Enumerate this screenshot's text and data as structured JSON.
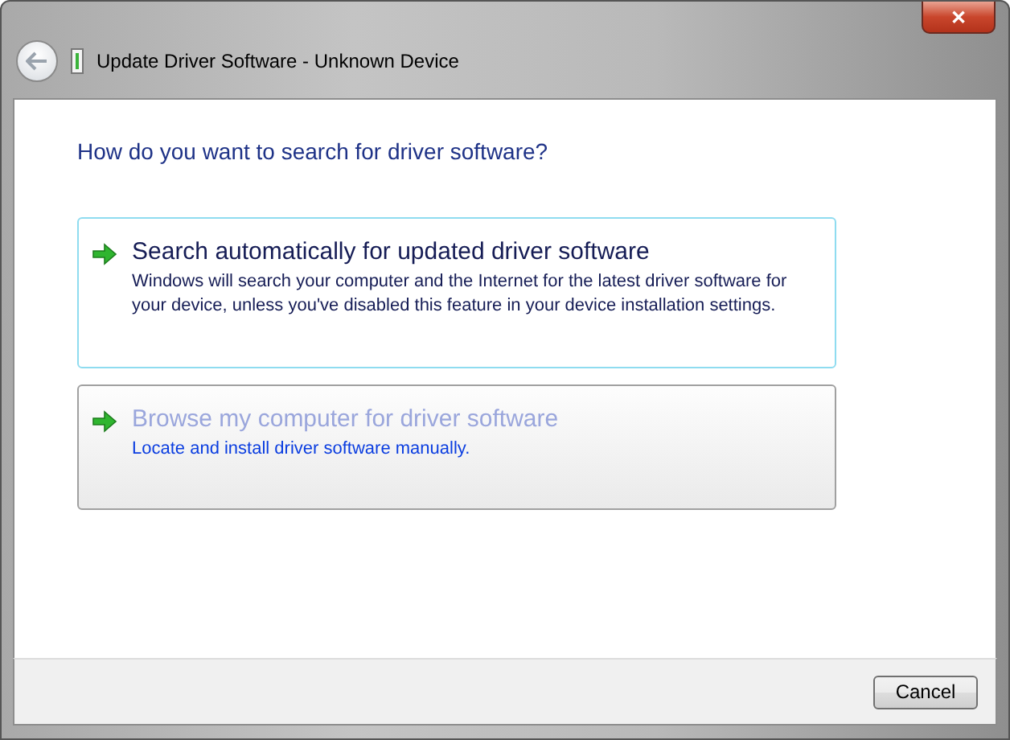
{
  "window": {
    "title": "Update Driver Software - Unknown Device",
    "close": "✕"
  },
  "heading": "How do you want to search for driver software?",
  "options": [
    {
      "title": "Search automatically for updated driver software",
      "description": "Windows will search your computer and the Internet for the latest driver software for your device, unless you've disabled this feature in your device installation settings.",
      "focused": true,
      "hovered": false
    },
    {
      "title": "Browse my computer for driver software",
      "description": "Locate and install driver software manually.",
      "focused": false,
      "hovered": true
    }
  ],
  "buttons": [
    "Cancel"
  ]
}
